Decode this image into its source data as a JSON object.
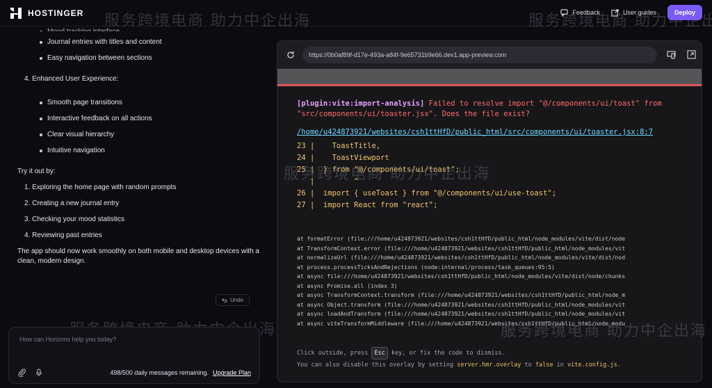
{
  "brand": {
    "name": "HOSTINGER"
  },
  "watermark": {
    "text": "服务跨境电商 助力中企出海"
  },
  "topbar": {
    "feedback": "Feedback",
    "guides": "User guides",
    "deploy": "Deploy"
  },
  "chat": {
    "cut_off_line": "Mood tracking interface",
    "bullets_a": [
      "Journal entries with titles and content",
      "Easy navigation between sections"
    ],
    "heading_4": "4. Enhanced User Experience:",
    "bullets_b": [
      "Smooth page transitions",
      "Interactive feedback on all actions",
      "Clear visual hierarchy",
      "Intuitive navigation"
    ],
    "try_label": "Try it out by:",
    "steps": [
      "1. Exploring the home page with random prompts",
      "2. Creating a new journal entry",
      "3. Checking your mood statistics",
      "4. Reviewing past entries"
    ],
    "closing": "The app should now work smoothly on both mobile and desktop devices with a clean, modern design.",
    "undo": "Undo"
  },
  "input": {
    "placeholder": "How can Horizons help you today?",
    "remaining": "498/500 daily messages remaining.",
    "upgrade": "Upgrade Plan"
  },
  "preview": {
    "url": "https://0b0af89f-d17e-493a-a84f-9e65731b9e66.dev1.app-preview.com",
    "error": {
      "plugin": "[plugin:vite:import-analysis]",
      "message_line1": " Failed to resolve import \"@/components/ui/toast\" from",
      "message_line2": "\"src/components/ui/toaster.jsx\". Does the file exist?",
      "file": "/home/u424873921/websites/csh1ttHfD/public_html/src/components/ui/toaster.jsx:8:7",
      "code_lines": [
        "23 |    ToastTitle,",
        "24 |    ToastViewport",
        "25 |  } from \"@/components/ui/toast\";",
        "   |         ^",
        "26 |  import { useToast } from \"@/components/ui/use-toast\";",
        "27 |  import React from \"react\";"
      ],
      "stack": [
        "at formatError (file:///home/u424873921/websites/csh1ttHfD/public_html/node_modules/vite/dist/node",
        "at TransformContext.error (file:///home/u424873921/websites/csh1ttHfD/public_html/node_modules/vit",
        "at normalizeUrl (file:///home/u424873921/websites/csh1ttHfD/public_html/node_modules/vite/dist/nod",
        "at process.processTicksAndRejections (node:internal/process/task_queues:95:5)",
        "at async file:///home/u424873921/websites/csh1ttHfD/public_html/node_modules/vite/dist/node/chunks",
        "at async Promise.all (index 3)",
        "at async TransformContext.transform (file:///home/u424873921/websites/csh1ttHfD/public_html/node_m",
        "at async Object.transform (file:///home/u424873921/websites/csh1ttHfD/public_html/node_modules/vit",
        "at async loadAndTransform (file:///home/u424873921/websites/csh1ttHfD/public_html/node_modules/vit",
        "at async viteTransformMiddleware (file:///home/u424873921/websites/csh1ttHfD/public_html/node_modu"
      ],
      "tip1_a": "Click outside, press ",
      "tip1_key": "Esc",
      "tip1_b": " key, or fix the code to dismiss.",
      "tip2_a": "You can also disable this overlay by setting ",
      "tip2_code1": "server.hmr.overlay",
      "tip2_b": " to ",
      "tip2_code2": "false",
      "tip2_c": " in ",
      "tip2_code3": "vite.config.js",
      "tip2_d": "."
    }
  },
  "colors": {
    "accent": "#7a5af8",
    "error": "#ff6b6b",
    "plugin": "#e6a1ff",
    "link": "#6fd8ff"
  }
}
